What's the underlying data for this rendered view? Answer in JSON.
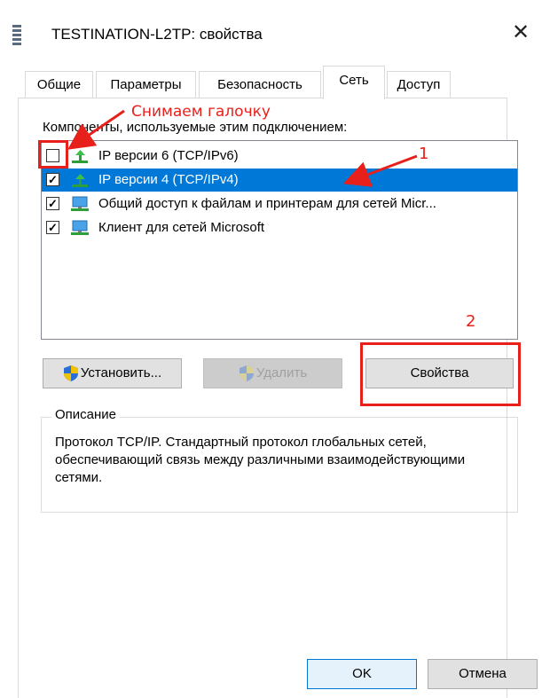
{
  "window": {
    "title": "TESTINATION-L2TP: свойства",
    "close_icon": "close-icon"
  },
  "tabs": [
    {
      "label": "Общие"
    },
    {
      "label": "Параметры"
    },
    {
      "label": "Безопасность"
    },
    {
      "label": "Сеть",
      "active": true
    },
    {
      "label": "Доступ"
    }
  ],
  "components": {
    "label": "Компоненты, используемые этим подключением:",
    "items": [
      {
        "label": "IP версии 6 (TCP/IPv6)",
        "checked": false,
        "selected": false,
        "icon": "network-protocol-icon"
      },
      {
        "label": "IP версии 4 (TCP/IPv4)",
        "checked": true,
        "selected": true,
        "icon": "network-protocol-icon"
      },
      {
        "label": "Общий доступ к файлам и принтерам для сетей Micr...",
        "checked": true,
        "selected": false,
        "icon": "network-service-icon"
      },
      {
        "label": "Клиент для сетей Microsoft",
        "checked": true,
        "selected": false,
        "icon": "network-client-icon"
      }
    ]
  },
  "buttons": {
    "install": "Установить...",
    "remove": "Удалить",
    "properties": "Свойства",
    "ok": "OK",
    "cancel": "Отмена"
  },
  "description": {
    "legend": "Описание",
    "text": "Протокол TCP/IP. Стандартный протокол глобальных сетей, обеспечивающий связь между различными взаимодействующими сетями."
  },
  "annotations": {
    "uncheck_note": "Снимаем галочку",
    "step1": "1",
    "step2": "2",
    "color": "#e8201c"
  },
  "colors": {
    "selection": "#0078d7",
    "button_face": "#e1e1e1"
  }
}
